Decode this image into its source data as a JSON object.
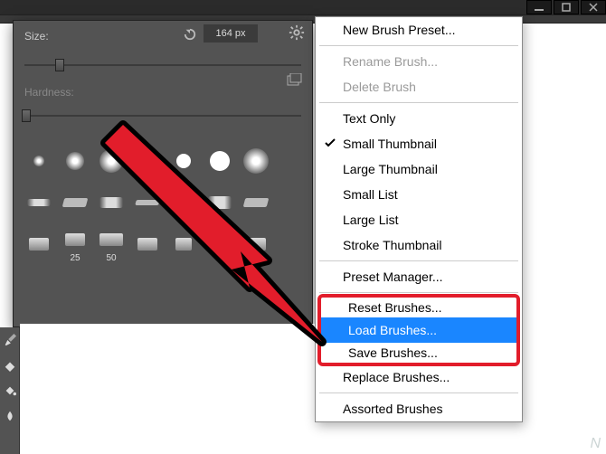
{
  "toolstrip": {
    "num": "164"
  },
  "panel": {
    "size_label": "Size:",
    "size_value": "164 px",
    "hardness_label": "Hardness:"
  },
  "brush_labels": [
    "",
    "",
    "",
    "",
    "",
    "",
    "",
    "",
    "",
    "",
    "",
    "",
    "",
    "",
    "",
    "25",
    "50",
    "",
    "",
    "",
    ""
  ],
  "menu": {
    "new_preset": "New Brush Preset...",
    "rename": "Rename Brush...",
    "delete": "Delete Brush",
    "text_only": "Text Only",
    "small_thumb": "Small Thumbnail",
    "large_thumb": "Large Thumbnail",
    "small_list": "Small List",
    "large_list": "Large List",
    "stroke_thumb": "Stroke Thumbnail",
    "preset_mgr": "Preset Manager...",
    "reset": "Reset Brushes...",
    "load": "Load Brushes...",
    "save": "Save Brushes...",
    "replace": "Replace Brushes...",
    "assorted": "Assorted Brushes"
  },
  "watermark": "N"
}
